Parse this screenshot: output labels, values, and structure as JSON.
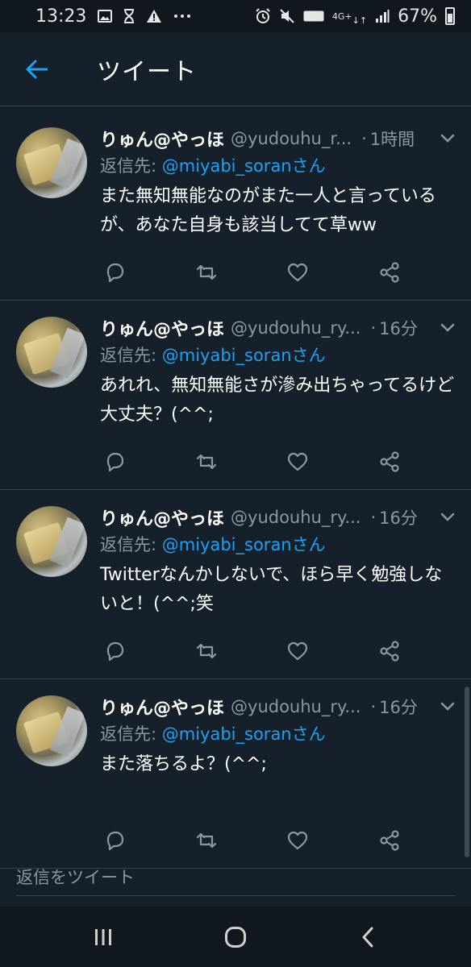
{
  "status_bar": {
    "time": "13:23",
    "battery": "67%",
    "network": "4G+",
    "volte": "VoLTE",
    "notification_icons": [
      "image-icon",
      "hourglass-icon",
      "warning-icon",
      "more-dots-icon"
    ],
    "system_icons": [
      "alarm-icon",
      "mute-icon",
      "volte-icon",
      "network-icon",
      "signal-icon",
      "battery-icon"
    ]
  },
  "header": {
    "title": "ツイート"
  },
  "tweets": [
    {
      "name": "りゅん@やっほ",
      "handle": "@yudouhu_r...",
      "time": "1時間",
      "reply_prefix": "返信先: ",
      "reply_to": "@miyabi_soran",
      "reply_suffix": "さん",
      "text": "また無知無能なのがまた一人と言っているが、あなた自身も該当してて草ww"
    },
    {
      "name": "りゅん@やっほ",
      "handle": "@yudouhu_ry...",
      "time": "16分",
      "reply_prefix": "返信先: ",
      "reply_to": "@miyabi_soran",
      "reply_suffix": "さん",
      "text": "あれれ、無知無能さが滲み出ちゃってるけど大丈夫？(^^;"
    },
    {
      "name": "りゅん@やっほ",
      "handle": "@yudouhu_ry...",
      "time": "16分",
      "reply_prefix": "返信先: ",
      "reply_to": "@miyabi_soran",
      "reply_suffix": "さん",
      "text": "Twitterなんかしないで、ほら早く勉強しないと！(^^;笑"
    },
    {
      "name": "りゅん@やっほ",
      "handle": "@yudouhu_ry...",
      "time": "16分",
      "reply_prefix": "返信先: ",
      "reply_to": "@miyabi_soran",
      "reply_suffix": "さん",
      "text": "また落ちるよ？(^^;"
    }
  ],
  "reply_bar": {
    "placeholder": "返信をツイート"
  },
  "colors": {
    "background": "#15202b",
    "accent": "#1da1f2",
    "secondary_text": "#8899a6",
    "divider": "#38444d"
  }
}
